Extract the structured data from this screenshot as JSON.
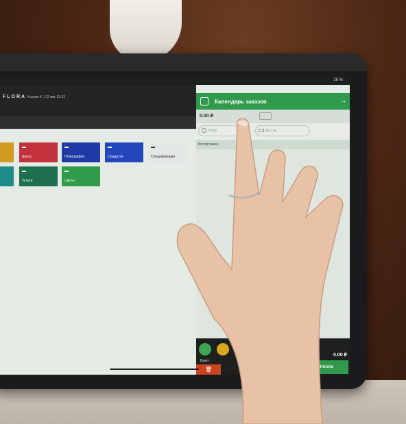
{
  "status_bar": {
    "battery": "26 %"
  },
  "app": {
    "logo": "FLORA",
    "user_info": "Ксения К. | 12 авг. 21:31"
  },
  "categories": [
    {
      "label": "",
      "color": "#d39a21"
    },
    {
      "label": "Декор",
      "color": "#c3323c"
    },
    {
      "label": "Полиграфия",
      "color": "#1e3aa6"
    },
    {
      "label": "Сладости",
      "color": "#2446bc"
    },
    {
      "label": "Спецификация",
      "color": "#e3e7e3"
    },
    {
      "label": "",
      "color": "#1f8a8a"
    },
    {
      "label": "Услуги",
      "color": "#1d6f4f"
    },
    {
      "label": "Цветы",
      "color": "#2f9a47"
    }
  ],
  "order_panel": {
    "title": "Календарь заказов",
    "sum": "0.00 ₽",
    "customer_placeholder": "Выбр",
    "delivery_placeholder": "Достав",
    "assortment_label": "Ассортимен",
    "bouquet_label": "Букет",
    "total": "0.00 ₽",
    "pay_label": "Оплата"
  }
}
